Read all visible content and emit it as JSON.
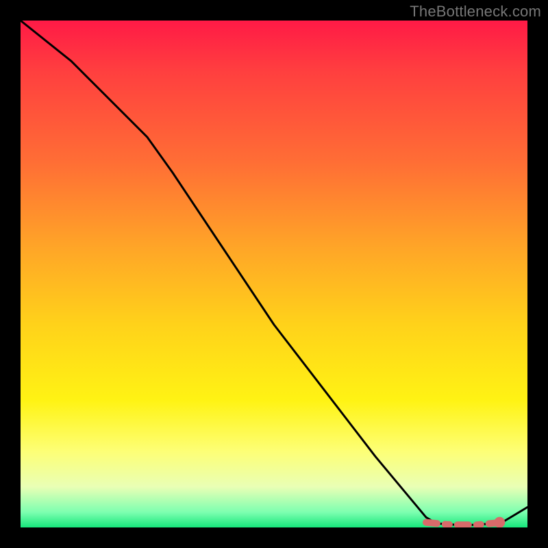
{
  "watermark": "TheBottleneck.com",
  "chart_data": {
    "type": "line",
    "title": "",
    "xlabel": "",
    "ylabel": "",
    "xlim": [
      0,
      100
    ],
    "ylim": [
      0,
      100
    ],
    "grid": false,
    "legend": false,
    "series": [
      {
        "name": "bottleneck-curve",
        "style": "black-solid",
        "x": [
          0,
          10,
          20,
          25,
          30,
          40,
          50,
          60,
          70,
          80,
          82,
          86,
          90,
          93,
          95,
          100
        ],
        "values": [
          100,
          92,
          82,
          77,
          70,
          55,
          40,
          27,
          14,
          2,
          0.8,
          0.5,
          0.5,
          0.8,
          1.0,
          4
        ]
      },
      {
        "name": "optimal-range",
        "style": "red-dashed",
        "x": [
          80,
          82,
          84,
          86,
          88,
          90,
          92,
          94
        ],
        "values": [
          1.0,
          0.8,
          0.6,
          0.5,
          0.5,
          0.5,
          0.7,
          0.9
        ]
      }
    ],
    "markers": [
      {
        "name": "current-config-dot",
        "x": 94.5,
        "y": 1.0
      }
    ],
    "background": {
      "type": "vertical-gradient",
      "stops": [
        {
          "pos": 0.0,
          "color": "#ff1a46"
        },
        {
          "pos": 0.5,
          "color": "#ffc91e"
        },
        {
          "pos": 0.8,
          "color": "#fff314"
        },
        {
          "pos": 1.0,
          "color": "#16e67b"
        }
      ]
    }
  }
}
